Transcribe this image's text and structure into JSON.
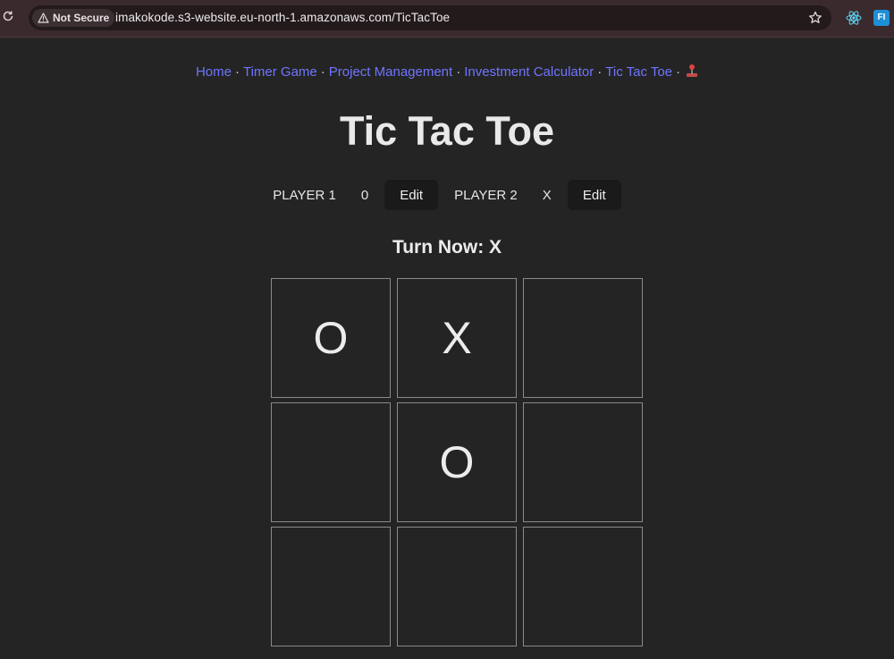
{
  "browser": {
    "security_label": "Not Secure",
    "url": "imakokode.s3-website.eu-north-1.amazonaws.com/TicTacToe",
    "extension_fi": "FI"
  },
  "nav": {
    "links": [
      "Home",
      "Timer Game",
      "Project Management",
      "Investment Calculator",
      "Tic Tac Toe"
    ],
    "separator": "·"
  },
  "page": {
    "title": "Tic Tac Toe",
    "turn_label": "Turn Now: X"
  },
  "players": [
    {
      "name": "PLAYER 1",
      "symbol": "0",
      "edit_label": "Edit"
    },
    {
      "name": "PLAYER 2",
      "symbol": "X",
      "edit_label": "Edit"
    }
  ],
  "board": {
    "cells": [
      "O",
      "X",
      "",
      "",
      "O",
      "",
      "",
      "",
      ""
    ]
  }
}
